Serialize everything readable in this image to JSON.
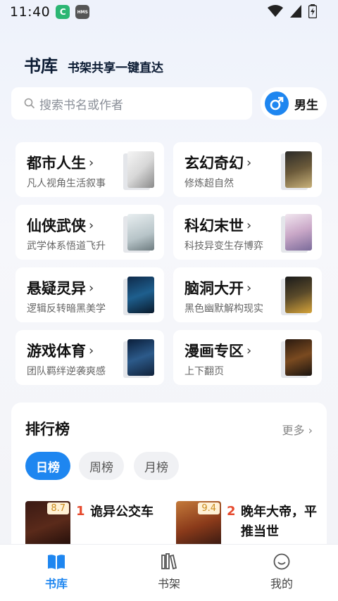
{
  "status_bar": {
    "time": "11:40",
    "app_icon_1": "C",
    "app_icon_2": "HMS"
  },
  "header": {
    "title": "书库",
    "subtitle": "书架共享一键直达"
  },
  "search": {
    "placeholder": "搜索书名或作者"
  },
  "gender": {
    "label": "男生"
  },
  "categories": [
    {
      "name": "都市人生",
      "desc": "凡人视角生活叙事"
    },
    {
      "name": "玄幻奇幻",
      "desc": "修炼超自然"
    },
    {
      "name": "仙侠武侠",
      "desc": "武学体系悟道飞升"
    },
    {
      "name": "科幻末世",
      "desc": "科技异变生存博弈"
    },
    {
      "name": "悬疑灵异",
      "desc": "逻辑反转暗黑美学"
    },
    {
      "name": "脑洞大开",
      "desc": "黑色幽默解构现实"
    },
    {
      "name": "游戏体育",
      "desc": "团队羁绊逆袭爽感"
    },
    {
      "name": "漫画专区",
      "desc": "上下翻页"
    }
  ],
  "ranking": {
    "title": "排行榜",
    "more": "更多",
    "tabs": [
      "日榜",
      "周榜",
      "月榜"
    ],
    "books": [
      {
        "rank": "1",
        "title": "诡异公交车",
        "score": "8.7"
      },
      {
        "rank": "2",
        "title": "晚年大帝，平推当世",
        "score": "9.4"
      }
    ]
  },
  "nav": {
    "items": [
      "书库",
      "书架",
      "我的"
    ]
  },
  "colors": {
    "accent": "#1e86f0",
    "rank_number": "#e64a2e"
  }
}
